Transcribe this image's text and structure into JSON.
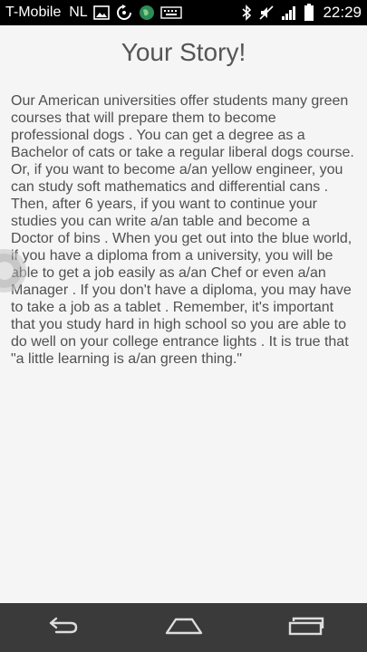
{
  "status_bar": {
    "carrier": "T-Mobile  NL",
    "time": "22:29",
    "icons": [
      "image-icon",
      "sync-icon",
      "globe-icon",
      "keyboard-icon",
      "bluetooth-icon",
      "mute-icon",
      "signal-icon",
      "battery-icon"
    ]
  },
  "page": {
    "title": "Your Story!",
    "story": "Our American universities offer students many green courses that will prepare them to become professional dogs . You can get a degree as a Bachelor of cats or take a regular liberal dogs course. Or, if you want to become a/an yellow engineer, you can study soft mathematics and differential cans . Then, after 6 years, if you want to continue your studies you can write a/an table and become a Doctor of bins . When you get out into the blue world, if you have a diploma from a university, you will be able to get a job easily as a/an Chef or even a/an Manager . If you don't have a diploma, you may have to take a job as a tablet . Remember, it's important that you study hard in high school so you are able to do well on your college entrance lights . It is true that \"a little learning is a/an green thing.\""
  },
  "nav_bar": {
    "buttons": [
      "back-icon",
      "home-icon",
      "recent-apps-icon"
    ]
  },
  "colors": {
    "background": "#f5f5f5",
    "status_bar": "#000000",
    "nav_bar": "#3a3a3a",
    "text": "#505050",
    "title": "#555555"
  }
}
